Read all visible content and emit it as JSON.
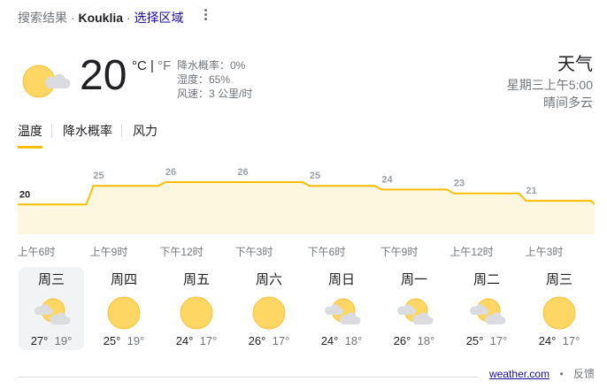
{
  "header": {
    "prefix": "搜索结果 · ",
    "location": "Kouklia",
    "separator": " · ",
    "choose_region": "选择区域"
  },
  "current": {
    "icon": "partly-cloudy-icon",
    "temperature": "20",
    "unit_c": "°C",
    "unit_sep": " | ",
    "unit_f": "°F",
    "precip": "降水概率：0%",
    "humidity": "湿度：65%",
    "wind": "风速：3 公里/时"
  },
  "side": {
    "title": "天气",
    "datetime": "星期三上午5:00",
    "condition": "晴间多云"
  },
  "tabs": [
    "温度",
    "降水概率",
    "风力"
  ],
  "chart_data": {
    "type": "area",
    "x": [
      "上午6时",
      "上午9时",
      "下午12时",
      "下午3时",
      "下午6时",
      "下午9时",
      "上午12时",
      "上午3时"
    ],
    "values": [
      20,
      25,
      26,
      26,
      25,
      24,
      23,
      21
    ],
    "value_labels": [
      "20",
      "25",
      "26",
      "26",
      "25",
      "24",
      "23",
      "21"
    ],
    "color": "#fbbc04",
    "fill": "#fef7e0"
  },
  "days": [
    {
      "name": "周三",
      "icon": "partly-cloudy-icon",
      "high": "27°",
      "low": "19°",
      "selected": true
    },
    {
      "name": "周四",
      "icon": "sunny-icon",
      "high": "25°",
      "low": "19°"
    },
    {
      "name": "周五",
      "icon": "sunny-icon",
      "high": "24°",
      "low": "17°"
    },
    {
      "name": "周六",
      "icon": "sunny-icon",
      "high": "26°",
      "low": "17°"
    },
    {
      "name": "周日",
      "icon": "partly-cloudy-icon",
      "high": "24°",
      "low": "18°"
    },
    {
      "name": "周一",
      "icon": "partly-cloudy-icon",
      "high": "26°",
      "low": "18°"
    },
    {
      "name": "周二",
      "icon": "partly-cloudy-icon",
      "high": "25°",
      "low": "17°"
    },
    {
      "name": "周三",
      "icon": "sunny-icon",
      "high": "24°",
      "low": "17°"
    }
  ],
  "footer": {
    "source": "weather.com",
    "dot": "•",
    "feedback": "反馈"
  }
}
